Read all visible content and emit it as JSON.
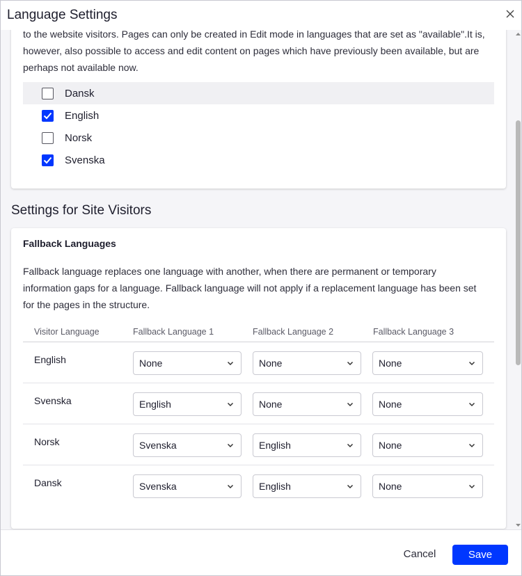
{
  "dialog": {
    "title": "Language Settings"
  },
  "availability": {
    "intro_text": "to the website visitors. Pages can only be created in Edit mode in languages that are set as \"available\".It is, however, also possible to access and edit content on pages which have previously been available, but are perhaps not available now.",
    "languages": [
      {
        "label": "Dansk",
        "checked": false
      },
      {
        "label": "English",
        "checked": true
      },
      {
        "label": "Norsk",
        "checked": false
      },
      {
        "label": "Svenska",
        "checked": true
      }
    ]
  },
  "visitors": {
    "section_title": "Settings for Site Visitors",
    "fallback_title": "Fallback Languages",
    "fallback_description": "Fallback language replaces one language with another, when there are permanent or temporary information gaps for a language. Fallback language will not apply if a replacement language has been set for the pages in the structure.",
    "columns": [
      "Visitor Language",
      "Fallback Language 1",
      "Fallback Language 2",
      "Fallback Language 3"
    ],
    "rows": [
      {
        "language": "English",
        "fallbacks": [
          "None",
          "None",
          "None"
        ]
      },
      {
        "language": "Svenska",
        "fallbacks": [
          "English",
          "None",
          "None"
        ]
      },
      {
        "language": "Norsk",
        "fallbacks": [
          "Svenska",
          "English",
          "None"
        ]
      },
      {
        "language": "Dansk",
        "fallbacks": [
          "Svenska",
          "English",
          "None"
        ]
      }
    ]
  },
  "footer": {
    "cancel_label": "Cancel",
    "save_label": "Save"
  },
  "colors": {
    "accent": "#0037ff",
    "background": "#f5f5f8"
  }
}
